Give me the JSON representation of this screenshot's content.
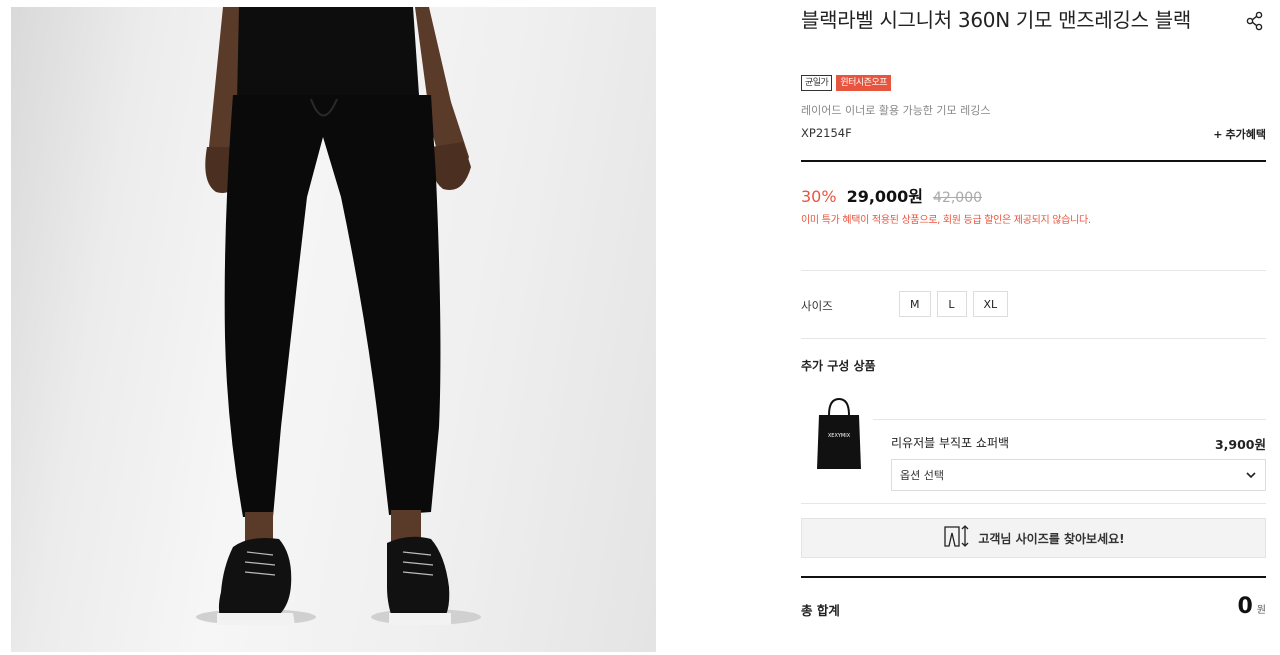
{
  "product": {
    "title": "블랙라벨 시그니처 360N 기모 맨즈레깅스 블랙",
    "badges": [
      "균일가",
      "윈터시즌오프"
    ],
    "description": "레이어드 이너로 활용 가능한 기모 레깅스",
    "code": "XP2154F",
    "extra_benefit": "추가혜택"
  },
  "pricing": {
    "discount": "30%",
    "price": "29,000원",
    "original": "42,000",
    "notice": "이미 특가 혜택이 적용된 상품으로, 회원 등급 할인은 제공되지 않습니다."
  },
  "size": {
    "label": "사이즈",
    "options": [
      "M",
      "L",
      "XL"
    ]
  },
  "addon": {
    "title": "추가 구성 상품",
    "name": "리유저블 부직포 쇼퍼백",
    "price": "3,900원",
    "select_placeholder": "옵션 선택",
    "bag_brand": "XEXYMIX"
  },
  "size_finder": {
    "label": "고객님 사이즈를 찾아보세요!"
  },
  "total": {
    "label": "총 합계",
    "value": "0",
    "unit": "원"
  },
  "icons": {
    "share": "share-icon",
    "plus": "plus-icon",
    "chevron": "chevron-down-icon",
    "ruler": "pants-ruler-icon"
  },
  "colors": {
    "accent": "#e8553f",
    "text": "#222222",
    "divider": "#111111"
  }
}
